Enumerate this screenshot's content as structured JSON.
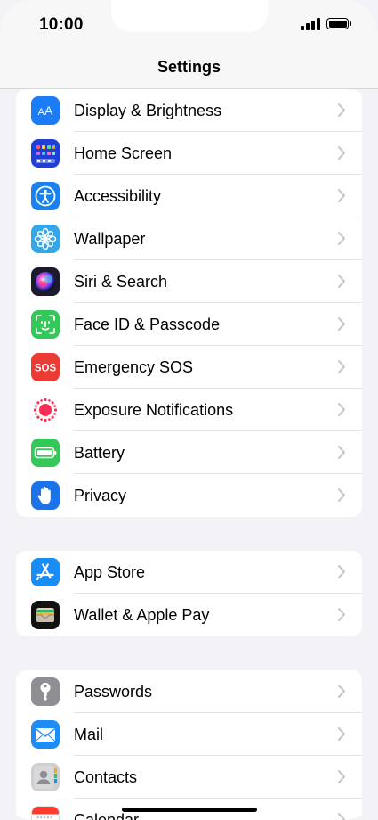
{
  "status_bar": {
    "time": "10:00"
  },
  "nav": {
    "title": "Settings"
  },
  "groups": [
    {
      "items": [
        {
          "label": "Display & Brightness",
          "icon": "display-brightness-icon",
          "color": "#1c7cf5",
          "glyph": "AA"
        },
        {
          "label": "Home Screen",
          "icon": "home-screen-icon",
          "color": "#1f3fd8"
        },
        {
          "label": "Accessibility",
          "icon": "accessibility-icon",
          "color": "#1a82f0"
        },
        {
          "label": "Wallpaper",
          "icon": "wallpaper-icon",
          "color": "#35a7e8"
        },
        {
          "label": "Siri & Search",
          "icon": "siri-icon",
          "color": "#1b1b2e"
        },
        {
          "label": "Face ID & Passcode",
          "icon": "face-id-icon",
          "color": "#34c759"
        },
        {
          "label": "Emergency SOS",
          "icon": "emergency-sos-icon",
          "color": "#ec3a35",
          "glyph": "SOS"
        },
        {
          "label": "Exposure Notifications",
          "icon": "exposure-notifications-icon",
          "color": "#ffffff"
        },
        {
          "label": "Battery",
          "icon": "battery-icon",
          "color": "#34c759"
        },
        {
          "label": "Privacy",
          "icon": "privacy-hand-icon",
          "color": "#1a73e8"
        }
      ]
    },
    {
      "items": [
        {
          "label": "App Store",
          "icon": "app-store-icon",
          "color": "#1a8cf5"
        },
        {
          "label": "Wallet & Apple Pay",
          "icon": "wallet-icon",
          "color": "#111111"
        }
      ]
    },
    {
      "items": [
        {
          "label": "Passwords",
          "icon": "passwords-key-icon",
          "color": "#8e8e93"
        },
        {
          "label": "Mail",
          "icon": "mail-icon",
          "color": "#1e8cf7"
        },
        {
          "label": "Contacts",
          "icon": "contacts-icon",
          "color": "#cfcfd1"
        },
        {
          "label": "Calendar",
          "icon": "calendar-icon",
          "color": "#ffffff"
        }
      ]
    }
  ]
}
